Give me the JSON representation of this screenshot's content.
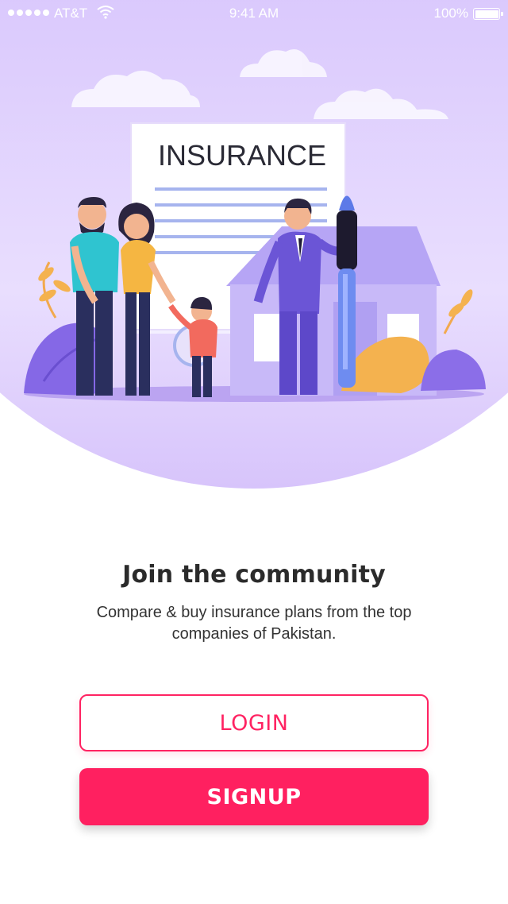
{
  "status_bar": {
    "carrier": "AT&T",
    "time": "9:41 AM",
    "battery": "100%"
  },
  "hero": {
    "document_heading": "INSURANCE"
  },
  "onboarding": {
    "title": "Join the community",
    "subtitle": "Compare & buy insurance plans from the top companies of Pakistan."
  },
  "actions": {
    "login_label": "LOGIN",
    "signup_label": "SIGNUP"
  },
  "colors": {
    "accent": "#ff2362",
    "hero_purple": "#cdb4fb"
  }
}
